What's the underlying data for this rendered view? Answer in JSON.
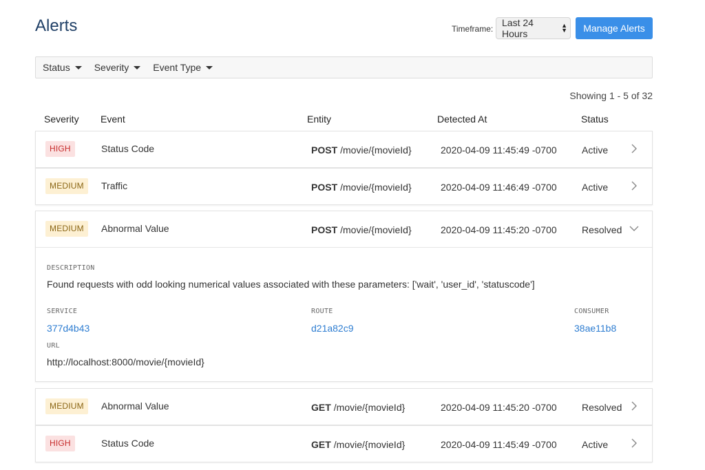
{
  "header": {
    "title": "Alerts",
    "timeframe_label": "Timeframe:",
    "timeframe_value": "Last 24 Hours",
    "manage_button": "Manage Alerts"
  },
  "filters": [
    "Status",
    "Severity",
    "Event Type"
  ],
  "showing_text": "Showing 1 - 5 of 32",
  "columns": [
    "Severity",
    "Event",
    "Entity",
    "Detected At",
    "Status"
  ],
  "rows": [
    {
      "severity": "HIGH",
      "event": "Status Code",
      "method": "POST",
      "path": "/movie/{movieId}",
      "detected": "2020-04-09 11:45:49 -0700",
      "status": "Active"
    },
    {
      "severity": "MEDIUM",
      "event": "Traffic",
      "method": "POST",
      "path": "/movie/{movieId}",
      "detected": "2020-04-09 11:46:49 -0700",
      "status": "Active"
    },
    {
      "severity": "MEDIUM",
      "event": "Abnormal Value",
      "method": "POST",
      "path": "/movie/{movieId}",
      "detected": "2020-04-09 11:45:20 -0700",
      "status": "Resolved"
    },
    {
      "severity": "MEDIUM",
      "event": "Abnormal Value",
      "method": "GET",
      "path": "/movie/{movieId}",
      "detected": "2020-04-09 11:45:20 -0700",
      "status": "Resolved"
    },
    {
      "severity": "HIGH",
      "event": "Status Code",
      "method": "GET",
      "path": "/movie/{movieId}",
      "detected": "2020-04-09 11:45:49 -0700",
      "status": "Active"
    }
  ],
  "expanded": {
    "description_label": "DESCRIPTION",
    "description": "Found requests with odd looking numerical values associated with these parameters: ['wait', 'user_id', 'statuscode']",
    "service_label": "SERVICE",
    "service": "377d4b43",
    "route_label": "ROUTE",
    "route": "d21a82c9",
    "consumer_label": "CONSUMER",
    "consumer": "38ae11b8",
    "url_label": "URL",
    "url": "http://localhost:8000/movie/{movieId}"
  },
  "colors": {
    "accent": "#3a8fe8",
    "title": "#1f3f66",
    "link": "#2e7dd1",
    "high_bg": "#fbe1e1",
    "high_text": "#c62b2b",
    "medium_bg": "#fdf0d3",
    "medium_text": "#8a6514"
  }
}
